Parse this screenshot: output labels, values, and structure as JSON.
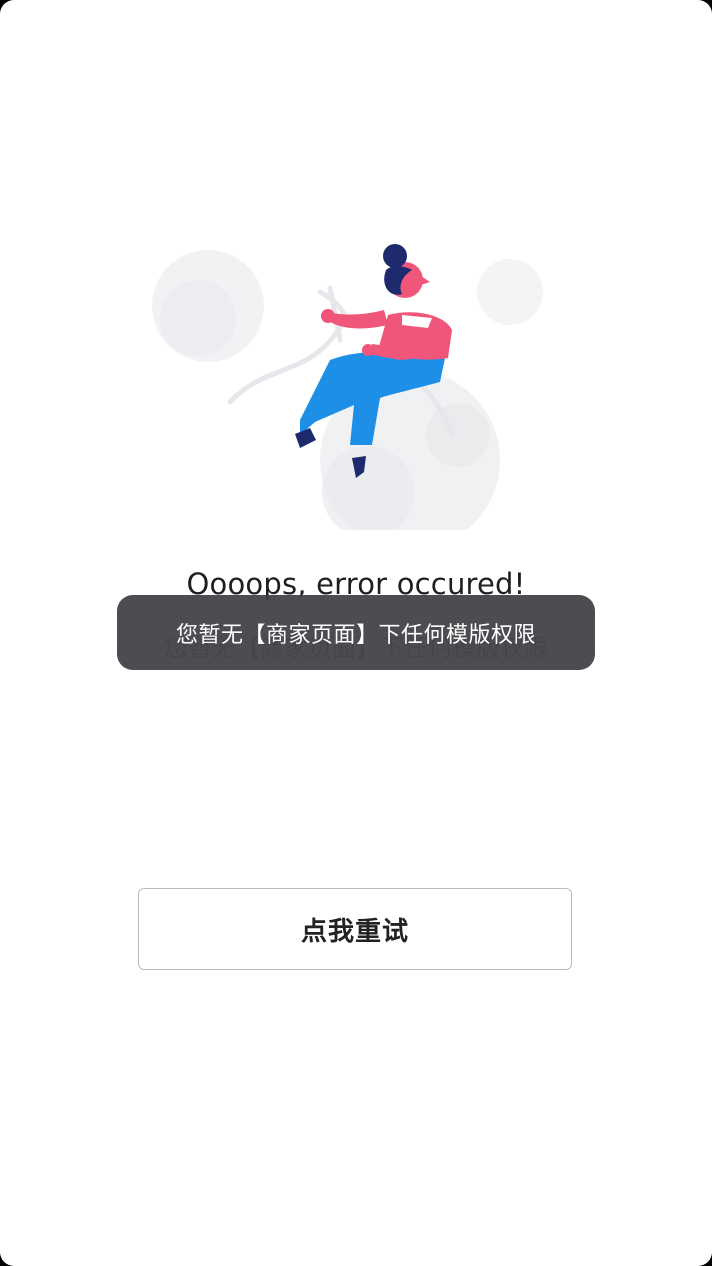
{
  "error": {
    "title": "Oooops, error occured!",
    "detail": "您暂无【商家页面】下任何模版权限"
  },
  "toast": {
    "message": "您暂无【商家页面】下任何模版权限"
  },
  "retry_button": {
    "label": "点我重试"
  },
  "colors": {
    "accent_pink": "#F0557A",
    "accent_blue": "#1E8FE6",
    "hair_navy": "#1E2A6E",
    "toast_bg": "#3E3F44"
  },
  "icons": {
    "illustration": "error-illustration-woman-sitting-on-cloud"
  }
}
